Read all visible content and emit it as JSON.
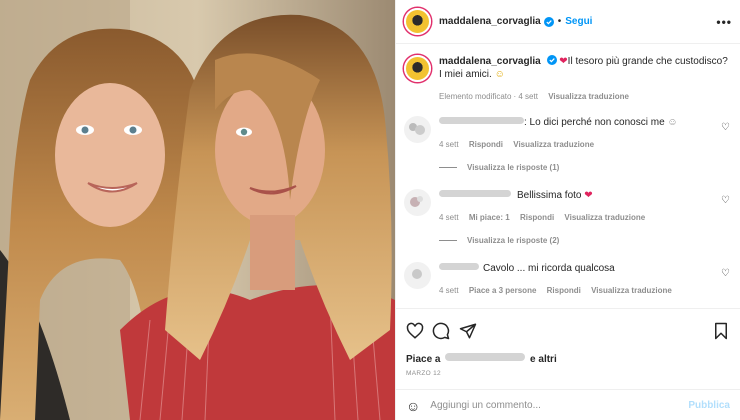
{
  "header": {
    "username": "maddalena_corvaglia",
    "separator": "•",
    "follow_label": "Segui",
    "more_label": "•••"
  },
  "caption": {
    "username": "maddalena_corvaglia",
    "text": "Il tesoro più grande che custodisco?",
    "text2": "I miei amici.",
    "edited": "Elemento modificato",
    "time": "4 sett",
    "translate": "Visualizza traduzione"
  },
  "comments": [
    {
      "text": ": Lo dici perché non conosci me",
      "time": "4 sett",
      "reply": "Rispondi",
      "translate": "Visualizza traduzione",
      "replies": "Visualizza le risposte (1)"
    },
    {
      "text": "Bellissima foto",
      "time": "4 sett",
      "likes": "Mi piace: 1",
      "reply": "Rispondi",
      "translate": "Visualizza traduzione",
      "replies": "Visualizza le risposte (2)"
    },
    {
      "text": "Cavolo ... mi ricorda qualcosa",
      "time": "4 sett",
      "likes": "Piace a 3 persone",
      "reply": "Rispondi",
      "translate": "Visualizza traduzione"
    }
  ],
  "likes": {
    "prefix": "Piace a",
    "suffix": "e altri"
  },
  "date": "MARZO 12",
  "add_comment": {
    "placeholder": "Aggiungi un commento...",
    "publish": "Pubblica"
  },
  "colors": {
    "accent": "#0095f6",
    "heart": "#ed4956",
    "muted": "#8e8e8e"
  }
}
